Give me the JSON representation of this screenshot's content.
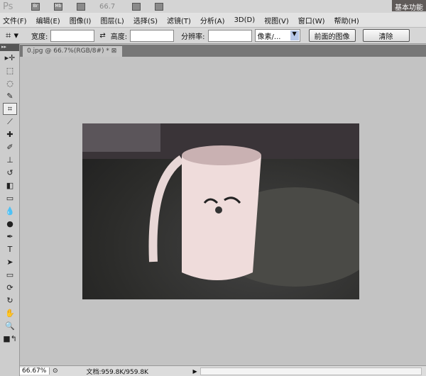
{
  "app": {
    "logo": "Ps",
    "zoom_value": "66.7",
    "workspace": "基本功能",
    "bridge_icon": "Br",
    "mini_bridge_icon": "Mb"
  },
  "menu": [
    "文件(F)",
    "编辑(E)",
    "图像(I)",
    "图层(L)",
    "选择(S)",
    "滤镜(T)",
    "分析(A)",
    "3D(D)",
    "视图(V)",
    "窗口(W)",
    "帮助(H)"
  ],
  "options": {
    "width_label": "宽度:",
    "width_value": "",
    "height_label": "高度:",
    "height_value": "",
    "resolution_label": "分辨率:",
    "resolution_value": "",
    "unit": "像素/...",
    "front_image": "前面的图像",
    "clear": "清除"
  },
  "document": {
    "tab_title": "0.jpg @ 66.7%(RGB/8#) *"
  },
  "status": {
    "zoom": "66.67%",
    "doc_size": "文档:959.8K/959.8K"
  },
  "colors": {
    "canvas_bg": "#c3c3c3",
    "menu_bg": "#e2e2e2"
  }
}
